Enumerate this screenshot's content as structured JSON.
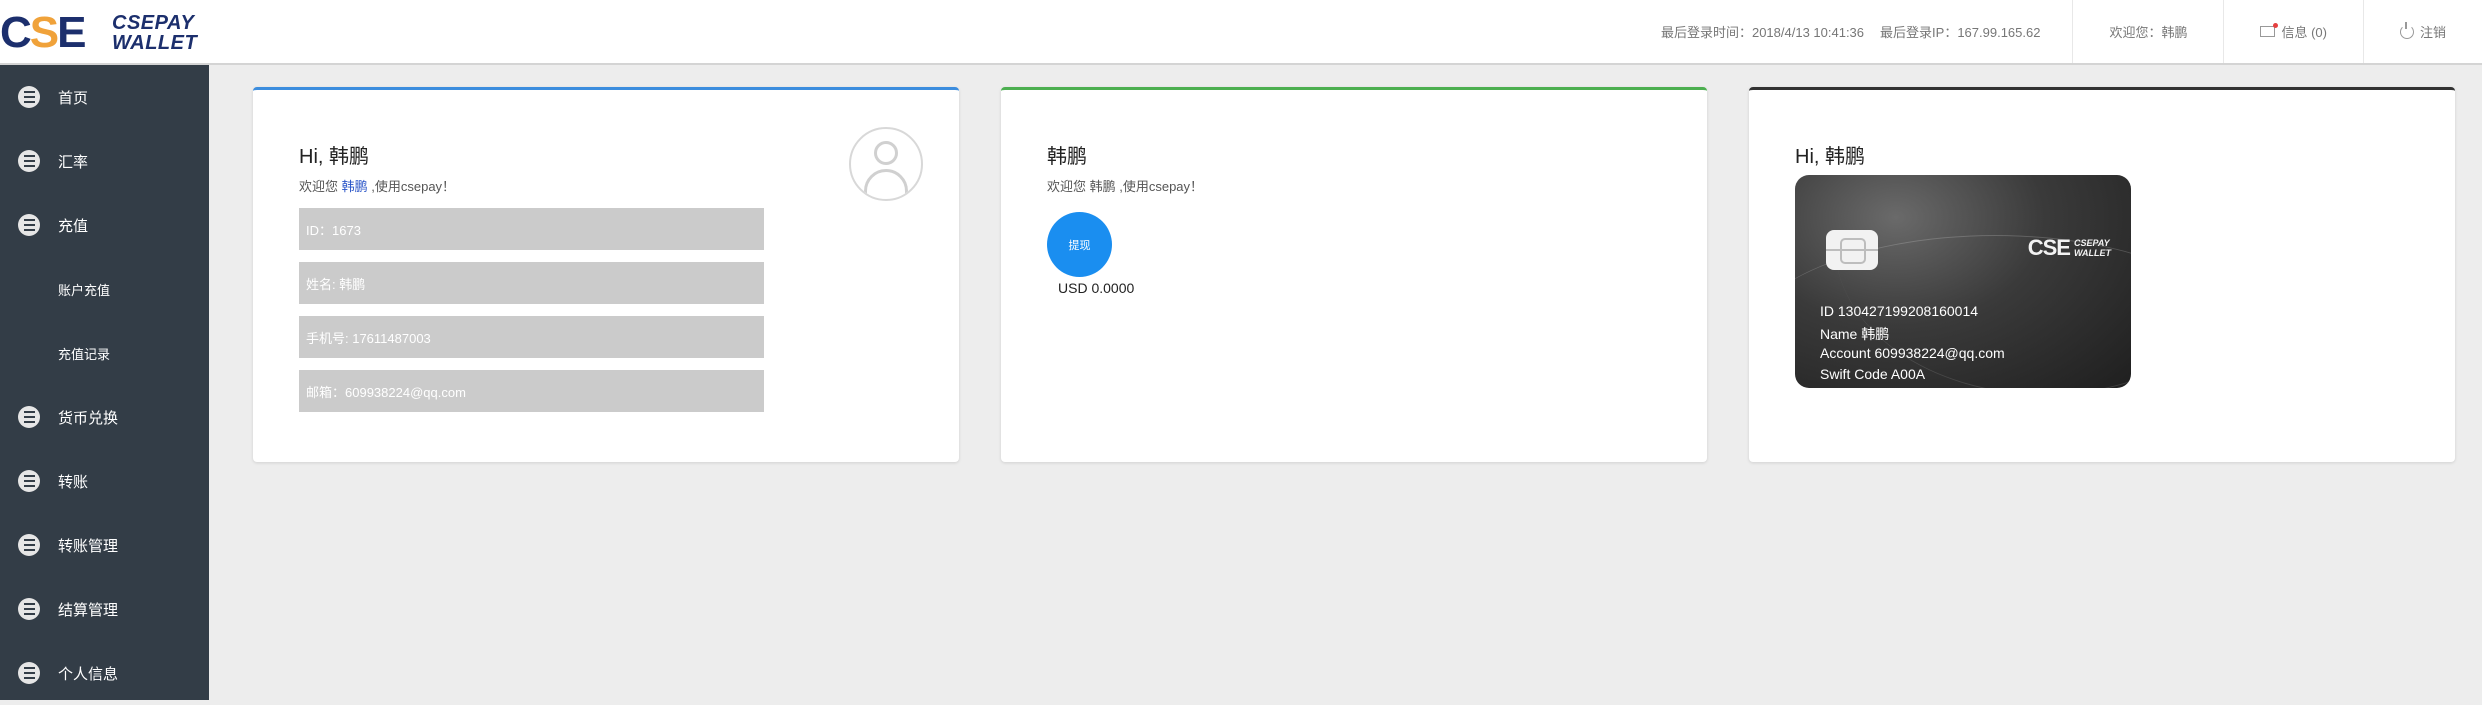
{
  "brand": {
    "mark_c": "C",
    "mark_s": "S",
    "mark_e": "E",
    "line1": "CSEPAY",
    "line2": "WALLET"
  },
  "header": {
    "last_login_time": "最后登录时间：2018/4/13 10:41:36",
    "last_login_ip": "最后登录IP：167.99.165.62",
    "welcome": "欢迎您：韩鹏",
    "messages": "信息 (0)",
    "logout": "注销"
  },
  "sidebar": {
    "items": [
      {
        "label": "首页"
      },
      {
        "label": "汇率"
      },
      {
        "label": "充值"
      },
      {
        "label": "账户充值"
      },
      {
        "label": "充值记录"
      },
      {
        "label": "货币兑换"
      },
      {
        "label": "转账"
      },
      {
        "label": "转账管理"
      },
      {
        "label": "结算管理"
      },
      {
        "label": "个人信息"
      }
    ]
  },
  "profile_card": {
    "title": "Hi, 韩鹏",
    "welcome_prefix": "欢迎您 ",
    "name": "韩鹏",
    "welcome_suffix": " ,使用csepay！",
    "fields": [
      "ID：1673",
      "姓名: 韩鹏",
      "手机号: 17611487003",
      "邮箱：609938224@qq.com"
    ]
  },
  "balance_card": {
    "title": "韩鹏",
    "subtitle": "欢迎您 韩鹏 ,使用csepay！",
    "withdraw_label": "提现",
    "balance": "USD 0.0000"
  },
  "bank_card_panel": {
    "title": "Hi, 韩鹏",
    "card": {
      "logo_mark": "CSE",
      "logo_line1": "CSEPAY",
      "logo_line2": "WALLET",
      "id_line": "ID 130427199208160014",
      "name_line": "Name 韩鹏",
      "account_line": "Account 609938224@qq.com",
      "swift_line": "Swift Code A00A"
    }
  },
  "colors": {
    "sidebar_bg": "#333d47",
    "accent_blue": "#1a8ef0",
    "card1_top": "#3c8dde",
    "card2_top": "#4caf50",
    "card3_top": "#333333"
  }
}
